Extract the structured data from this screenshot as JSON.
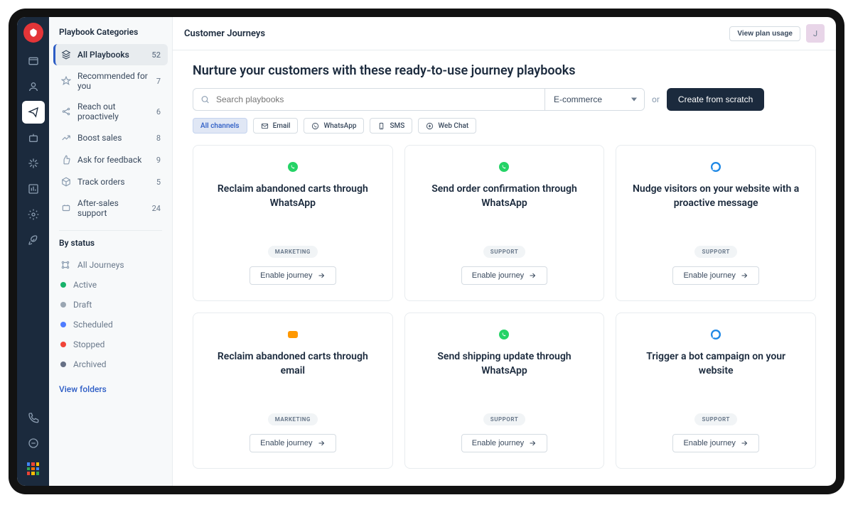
{
  "header": {
    "title": "Customer Journeys",
    "plan_usage": "View plan usage",
    "avatar_initial": "J"
  },
  "sidebar": {
    "categories_title": "Playbook Categories",
    "categories": [
      {
        "label": "All Playbooks",
        "count": 52,
        "icon": "layers"
      },
      {
        "label": "Recommended for you",
        "count": 7,
        "icon": "star"
      },
      {
        "label": "Reach out proactively",
        "count": 6,
        "icon": "share"
      },
      {
        "label": "Boost sales",
        "count": 8,
        "icon": "trend"
      },
      {
        "label": "Ask for feedback",
        "count": 9,
        "icon": "thumb"
      },
      {
        "label": "Track orders",
        "count": 5,
        "icon": "package"
      },
      {
        "label": "After-sales support",
        "count": 24,
        "icon": "support"
      }
    ],
    "status_title": "By status",
    "statuses": [
      {
        "label": "All Journeys",
        "dot": "",
        "icon": "journey"
      },
      {
        "label": "Active",
        "dot": "#17b26a"
      },
      {
        "label": "Draft",
        "dot": "#9aa6b2"
      },
      {
        "label": "Scheduled",
        "dot": "#4e7cff"
      },
      {
        "label": "Stopped",
        "dot": "#f04438"
      },
      {
        "label": "Archived",
        "dot": "#667085"
      }
    ],
    "view_folders": "View folders"
  },
  "main": {
    "heading": "Nurture your customers with these ready-to-use journey playbooks",
    "search_placeholder": "Search playbooks",
    "industry_selected": "E-commerce",
    "or_text": "or",
    "create_label": "Create from scratch",
    "chips": [
      {
        "label": "All channels",
        "active": true
      },
      {
        "label": "Email",
        "icon": "mail"
      },
      {
        "label": "WhatsApp",
        "icon": "whatsapp"
      },
      {
        "label": "SMS",
        "icon": "sms"
      },
      {
        "label": "Web Chat",
        "icon": "webchat"
      }
    ],
    "enable_label": "Enable journey",
    "cards": [
      {
        "icon": "whatsapp",
        "title": "Reclaim abandoned carts through WhatsApp",
        "tag": "MARKETING"
      },
      {
        "icon": "whatsapp",
        "title": "Send order confirmation through WhatsApp",
        "tag": "SUPPORT"
      },
      {
        "icon": "chat",
        "title": "Nudge visitors on your website with a proactive message",
        "tag": "SUPPORT"
      },
      {
        "icon": "email",
        "title": "Reclaim abandoned carts through email",
        "tag": "MARKETING"
      },
      {
        "icon": "whatsapp",
        "title": "Send shipping update through WhatsApp",
        "tag": "SUPPORT"
      },
      {
        "icon": "chat",
        "title": "Trigger a bot campaign on your website",
        "tag": "SUPPORT"
      }
    ]
  }
}
